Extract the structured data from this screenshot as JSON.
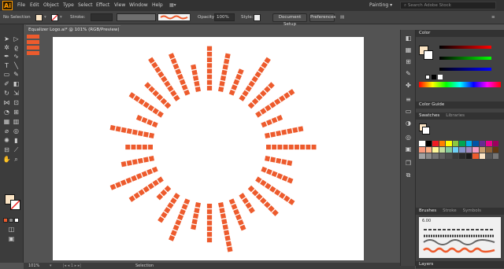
{
  "app": {
    "logo": "Ai",
    "workspace": "Painting",
    "workspace_chevron": "▾",
    "search_placeholder": "Search Adobe Stock"
  },
  "menu": [
    "File",
    "Edit",
    "Object",
    "Type",
    "Select",
    "Effect",
    "View",
    "Window",
    "Help"
  ],
  "control": {
    "selection_label": "No Selection",
    "stroke_label": "Stroke:",
    "opacity_label": "Opacity:",
    "opacity_value": "100%",
    "style_label": "Style:",
    "doc_setup": "Document Setup",
    "preferences": "Preferences"
  },
  "document": {
    "tab_title": "Equalizer Logo.ai* @ 101% (RGB/Preview)",
    "zoom": "101%",
    "tool_status": "Selection"
  },
  "panels": {
    "color": "Color",
    "color_guide": "Color Guide",
    "swatches": "Swatches",
    "libraries": "Libraries",
    "brushes": "Brushes",
    "stroke": "Stroke",
    "symbols": "Symbols",
    "layers": "Layers",
    "brush_size": "6.00"
  },
  "colors": {
    "accent": "#ed5b2d",
    "fill": "#fbe4c4",
    "ui_bg": "#535353",
    "panel_bg": "#424242"
  }
}
